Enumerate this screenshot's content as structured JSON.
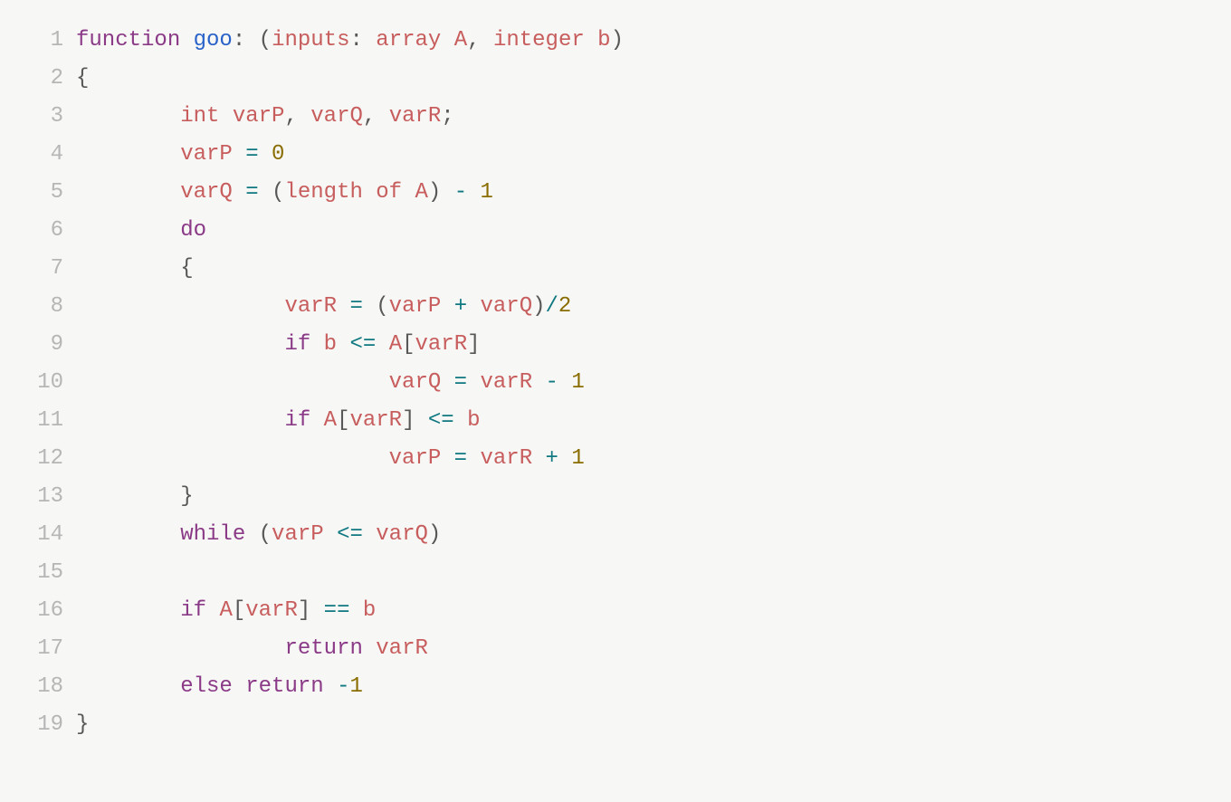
{
  "code": {
    "lines": [
      {
        "num": "1",
        "tokens": [
          {
            "cls": "tok-kw",
            "text": "function"
          },
          {
            "cls": "",
            "text": " "
          },
          {
            "cls": "tok-fn",
            "text": "goo"
          },
          {
            "cls": "tok-punc",
            "text": ":"
          },
          {
            "cls": "",
            "text": " "
          },
          {
            "cls": "tok-punc",
            "text": "("
          },
          {
            "cls": "tok-type",
            "text": "inputs"
          },
          {
            "cls": "tok-punc",
            "text": ":"
          },
          {
            "cls": "",
            "text": " "
          },
          {
            "cls": "tok-type",
            "text": "array"
          },
          {
            "cls": "",
            "text": " "
          },
          {
            "cls": "tok-ident",
            "text": "A"
          },
          {
            "cls": "tok-punc",
            "text": ","
          },
          {
            "cls": "",
            "text": " "
          },
          {
            "cls": "tok-type",
            "text": "integer"
          },
          {
            "cls": "",
            "text": " "
          },
          {
            "cls": "tok-ident",
            "text": "b"
          },
          {
            "cls": "tok-punc",
            "text": ")"
          }
        ]
      },
      {
        "num": "2",
        "tokens": [
          {
            "cls": "tok-punc",
            "text": "{"
          }
        ]
      },
      {
        "num": "3",
        "tokens": [
          {
            "cls": "",
            "text": "        "
          },
          {
            "cls": "tok-type",
            "text": "int"
          },
          {
            "cls": "",
            "text": " "
          },
          {
            "cls": "tok-ident",
            "text": "varP"
          },
          {
            "cls": "tok-punc",
            "text": ","
          },
          {
            "cls": "",
            "text": " "
          },
          {
            "cls": "tok-ident",
            "text": "varQ"
          },
          {
            "cls": "tok-punc",
            "text": ","
          },
          {
            "cls": "",
            "text": " "
          },
          {
            "cls": "tok-ident",
            "text": "varR"
          },
          {
            "cls": "tok-punc",
            "text": ";"
          }
        ]
      },
      {
        "num": "4",
        "tokens": [
          {
            "cls": "",
            "text": "        "
          },
          {
            "cls": "tok-ident",
            "text": "varP"
          },
          {
            "cls": "",
            "text": " "
          },
          {
            "cls": "tok-op",
            "text": "="
          },
          {
            "cls": "",
            "text": " "
          },
          {
            "cls": "tok-num",
            "text": "0"
          }
        ]
      },
      {
        "num": "5",
        "tokens": [
          {
            "cls": "",
            "text": "        "
          },
          {
            "cls": "tok-ident",
            "text": "varQ"
          },
          {
            "cls": "",
            "text": " "
          },
          {
            "cls": "tok-op",
            "text": "="
          },
          {
            "cls": "",
            "text": " "
          },
          {
            "cls": "tok-punc",
            "text": "("
          },
          {
            "cls": "tok-type",
            "text": "length"
          },
          {
            "cls": "",
            "text": " "
          },
          {
            "cls": "tok-type",
            "text": "of"
          },
          {
            "cls": "",
            "text": " "
          },
          {
            "cls": "tok-ident",
            "text": "A"
          },
          {
            "cls": "tok-punc",
            "text": ")"
          },
          {
            "cls": "",
            "text": " "
          },
          {
            "cls": "tok-op",
            "text": "-"
          },
          {
            "cls": "",
            "text": " "
          },
          {
            "cls": "tok-num",
            "text": "1"
          }
        ]
      },
      {
        "num": "6",
        "tokens": [
          {
            "cls": "",
            "text": "        "
          },
          {
            "cls": "tok-kw",
            "text": "do"
          }
        ]
      },
      {
        "num": "7",
        "tokens": [
          {
            "cls": "",
            "text": "        "
          },
          {
            "cls": "tok-punc",
            "text": "{"
          }
        ]
      },
      {
        "num": "8",
        "tokens": [
          {
            "cls": "",
            "text": "                "
          },
          {
            "cls": "tok-ident",
            "text": "varR"
          },
          {
            "cls": "",
            "text": " "
          },
          {
            "cls": "tok-op",
            "text": "="
          },
          {
            "cls": "",
            "text": " "
          },
          {
            "cls": "tok-punc",
            "text": "("
          },
          {
            "cls": "tok-ident",
            "text": "varP"
          },
          {
            "cls": "",
            "text": " "
          },
          {
            "cls": "tok-op",
            "text": "+"
          },
          {
            "cls": "",
            "text": " "
          },
          {
            "cls": "tok-ident",
            "text": "varQ"
          },
          {
            "cls": "tok-punc",
            "text": ")"
          },
          {
            "cls": "tok-op",
            "text": "/"
          },
          {
            "cls": "tok-num",
            "text": "2"
          }
        ]
      },
      {
        "num": "9",
        "tokens": [
          {
            "cls": "",
            "text": "                "
          },
          {
            "cls": "tok-kw",
            "text": "if"
          },
          {
            "cls": "",
            "text": " "
          },
          {
            "cls": "tok-ident",
            "text": "b"
          },
          {
            "cls": "",
            "text": " "
          },
          {
            "cls": "tok-op",
            "text": "<="
          },
          {
            "cls": "",
            "text": " "
          },
          {
            "cls": "tok-ident",
            "text": "A"
          },
          {
            "cls": "tok-punc",
            "text": "["
          },
          {
            "cls": "tok-ident",
            "text": "varR"
          },
          {
            "cls": "tok-punc",
            "text": "]"
          }
        ]
      },
      {
        "num": "10",
        "tokens": [
          {
            "cls": "",
            "text": "                        "
          },
          {
            "cls": "tok-ident",
            "text": "varQ"
          },
          {
            "cls": "",
            "text": " "
          },
          {
            "cls": "tok-op",
            "text": "="
          },
          {
            "cls": "",
            "text": " "
          },
          {
            "cls": "tok-ident",
            "text": "varR"
          },
          {
            "cls": "",
            "text": " "
          },
          {
            "cls": "tok-op",
            "text": "-"
          },
          {
            "cls": "",
            "text": " "
          },
          {
            "cls": "tok-num",
            "text": "1"
          }
        ]
      },
      {
        "num": "11",
        "tokens": [
          {
            "cls": "",
            "text": "                "
          },
          {
            "cls": "tok-kw",
            "text": "if"
          },
          {
            "cls": "",
            "text": " "
          },
          {
            "cls": "tok-ident",
            "text": "A"
          },
          {
            "cls": "tok-punc",
            "text": "["
          },
          {
            "cls": "tok-ident",
            "text": "varR"
          },
          {
            "cls": "tok-punc",
            "text": "]"
          },
          {
            "cls": "",
            "text": " "
          },
          {
            "cls": "tok-op",
            "text": "<="
          },
          {
            "cls": "",
            "text": " "
          },
          {
            "cls": "tok-ident",
            "text": "b"
          }
        ]
      },
      {
        "num": "12",
        "tokens": [
          {
            "cls": "",
            "text": "                        "
          },
          {
            "cls": "tok-ident",
            "text": "varP"
          },
          {
            "cls": "",
            "text": " "
          },
          {
            "cls": "tok-op",
            "text": "="
          },
          {
            "cls": "",
            "text": " "
          },
          {
            "cls": "tok-ident",
            "text": "varR"
          },
          {
            "cls": "",
            "text": " "
          },
          {
            "cls": "tok-op",
            "text": "+"
          },
          {
            "cls": "",
            "text": " "
          },
          {
            "cls": "tok-num",
            "text": "1"
          }
        ]
      },
      {
        "num": "13",
        "tokens": [
          {
            "cls": "",
            "text": "        "
          },
          {
            "cls": "tok-punc",
            "text": "}"
          }
        ]
      },
      {
        "num": "14",
        "tokens": [
          {
            "cls": "",
            "text": "        "
          },
          {
            "cls": "tok-kw",
            "text": "while"
          },
          {
            "cls": "",
            "text": " "
          },
          {
            "cls": "tok-punc",
            "text": "("
          },
          {
            "cls": "tok-ident",
            "text": "varP"
          },
          {
            "cls": "",
            "text": " "
          },
          {
            "cls": "tok-op",
            "text": "<="
          },
          {
            "cls": "",
            "text": " "
          },
          {
            "cls": "tok-ident",
            "text": "varQ"
          },
          {
            "cls": "tok-punc",
            "text": ")"
          }
        ]
      },
      {
        "num": "15",
        "tokens": []
      },
      {
        "num": "16",
        "tokens": [
          {
            "cls": "",
            "text": "        "
          },
          {
            "cls": "tok-kw",
            "text": "if"
          },
          {
            "cls": "",
            "text": " "
          },
          {
            "cls": "tok-ident",
            "text": "A"
          },
          {
            "cls": "tok-punc",
            "text": "["
          },
          {
            "cls": "tok-ident",
            "text": "varR"
          },
          {
            "cls": "tok-punc",
            "text": "]"
          },
          {
            "cls": "",
            "text": " "
          },
          {
            "cls": "tok-op",
            "text": "=="
          },
          {
            "cls": "",
            "text": " "
          },
          {
            "cls": "tok-ident",
            "text": "b"
          }
        ]
      },
      {
        "num": "17",
        "tokens": [
          {
            "cls": "",
            "text": "                "
          },
          {
            "cls": "tok-kw",
            "text": "return"
          },
          {
            "cls": "",
            "text": " "
          },
          {
            "cls": "tok-ident",
            "text": "varR"
          }
        ]
      },
      {
        "num": "18",
        "tokens": [
          {
            "cls": "",
            "text": "        "
          },
          {
            "cls": "tok-kw",
            "text": "else"
          },
          {
            "cls": "",
            "text": " "
          },
          {
            "cls": "tok-kw",
            "text": "return"
          },
          {
            "cls": "",
            "text": " "
          },
          {
            "cls": "tok-op",
            "text": "-"
          },
          {
            "cls": "tok-num",
            "text": "1"
          }
        ]
      },
      {
        "num": "19",
        "tokens": [
          {
            "cls": "tok-punc",
            "text": "}"
          }
        ]
      }
    ]
  }
}
